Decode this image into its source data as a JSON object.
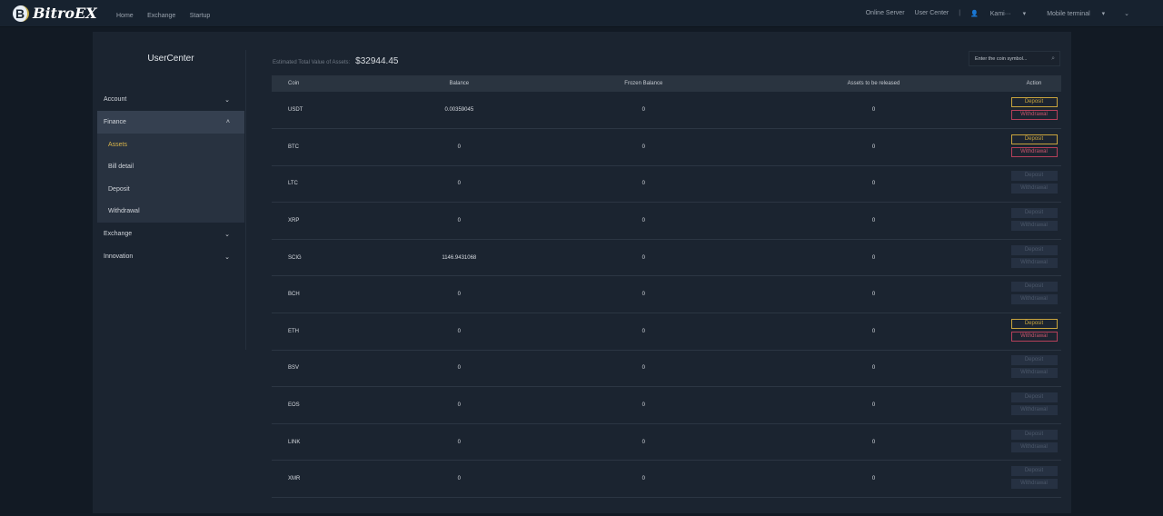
{
  "header": {
    "logo": "BitroEX",
    "logo_mark": "B",
    "nav": [
      "Home",
      "Exchange",
      "Startup"
    ],
    "online_server": "Online Server",
    "user_center": "User Center",
    "separator": "|",
    "user": "Kami···",
    "mobile": "Mobile terminal"
  },
  "sidebar": {
    "title": "UserCenter",
    "account": "Account",
    "finance": "Finance",
    "sub": [
      "Assets",
      "Bill detail",
      "Deposit",
      "Withdrawal"
    ],
    "exchange": "Exchange",
    "innovation": "Innovation"
  },
  "main": {
    "est_label": "Estimated Total Value of Assets:",
    "est_value": "$32944.45",
    "search_placeholder": "Enter the coin symbol...",
    "columns": [
      "Coin",
      "Balance",
      "Frozen Balance",
      "Assets to be released",
      "Action"
    ],
    "deposit_label": "Deposit",
    "withdrawal_label": "Withdrawal",
    "rows": [
      {
        "coin": "USDT",
        "balance": "0.00359045",
        "frozen": "0",
        "release": "0",
        "enabled": true
      },
      {
        "coin": "BTC",
        "balance": "0",
        "frozen": "0",
        "release": "0",
        "enabled": true
      },
      {
        "coin": "LTC",
        "balance": "0",
        "frozen": "0",
        "release": "0",
        "enabled": false
      },
      {
        "coin": "XRP",
        "balance": "0",
        "frozen": "0",
        "release": "0",
        "enabled": false
      },
      {
        "coin": "SCIG",
        "balance": "1146.9431068",
        "frozen": "0",
        "release": "0",
        "enabled": false
      },
      {
        "coin": "BCH",
        "balance": "0",
        "frozen": "0",
        "release": "0",
        "enabled": false
      },
      {
        "coin": "ETH",
        "balance": "0",
        "frozen": "0",
        "release": "0",
        "enabled": true
      },
      {
        "coin": "BSV",
        "balance": "0",
        "frozen": "0",
        "release": "0",
        "enabled": false
      },
      {
        "coin": "EOS",
        "balance": "0",
        "frozen": "0",
        "release": "0",
        "enabled": false
      },
      {
        "coin": "LINK",
        "balance": "0",
        "frozen": "0",
        "release": "0",
        "enabled": false
      },
      {
        "coin": "XMR",
        "balance": "0",
        "frozen": "0",
        "release": "0",
        "enabled": false
      }
    ]
  }
}
